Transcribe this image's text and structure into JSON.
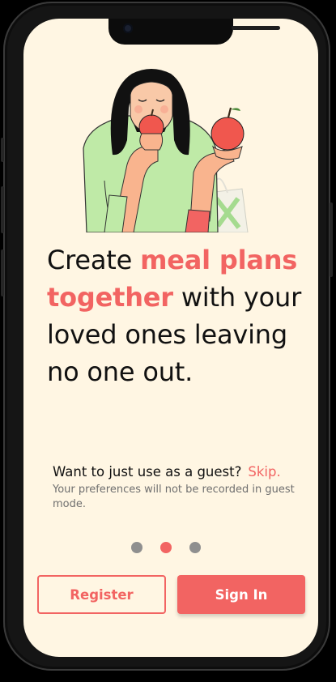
{
  "headline": {
    "part1": "Create ",
    "accent": "meal plans together",
    "part2": " with your loved ones leaving no one out."
  },
  "guest": {
    "question": "Want to just use as a guest?",
    "skip": "Skip.",
    "note": "Your preferences will not be recorded in guest mode."
  },
  "pager": {
    "count": 3,
    "active_index": 1
  },
  "buttons": {
    "register": "Register",
    "sign_in": "Sign In"
  },
  "colors": {
    "accent": "#F26462",
    "background": "#FFF6E3",
    "dot_inactive": "#8f8f8f"
  }
}
